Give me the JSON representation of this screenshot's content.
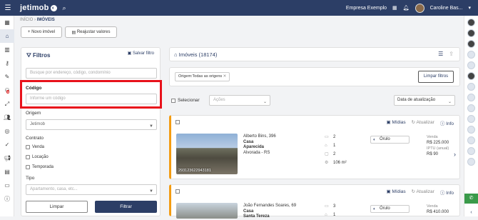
{
  "topbar": {
    "logo": "jetimob",
    "company": "Empresa Exemplo",
    "user": "Caroline Bas...",
    "icons": [
      "menu-icon",
      "search-icon",
      "grid-icon",
      "bell-icon",
      "chevron-down-icon"
    ]
  },
  "breadcrumb": {
    "home": "INÍCIO",
    "sep": "›",
    "current": "IMÓVEIS"
  },
  "actions": {
    "new": "Novo imóvel",
    "readjust": "Reajustar valores"
  },
  "filters": {
    "title": "Filtros",
    "save": "Salvar filtro",
    "search_placeholder": "Busque por endereço, código, condomínio",
    "code_label": "Código",
    "code_placeholder": "Informe um código",
    "origin_label": "Origem",
    "origin_value": "Jetimob",
    "contract_label": "Contrato",
    "contract_options": [
      "Venda",
      "Locação",
      "Temporada"
    ],
    "type_label": "Tipo",
    "type_placeholder": "Apartamento, casa, etc...",
    "clear": "Limpar",
    "apply": "Filtrar"
  },
  "listing": {
    "title": "Imóveis (18174)",
    "chip": "Origem:Todas as origens",
    "clear_filters": "Limpar filtros",
    "select_label": "Selecionar",
    "actions_placeholder": "Ações",
    "sort": "Data de atualização"
  },
  "cards": [
    {
      "media": "Mídias",
      "update": "Atualizar",
      "info": "Info",
      "code": "293123622943181",
      "address": "Alberto Bins, 396",
      "type": "Casa",
      "neighborhood": "Aparecida",
      "city": "Alvorada - RS",
      "bedrooms": "2",
      "suites": "1",
      "garage": "2",
      "area": "106 m²",
      "owner": "Órulo",
      "sale_label": "Venda",
      "sale_price": "R$ 225.000",
      "iptu_label": "IPTU (anual)",
      "iptu_value": "R$ 90"
    },
    {
      "media": "Mídias",
      "update": "Atualizar",
      "info": "Info",
      "address": "João Fernandes Soares, 69",
      "type": "Casa",
      "neighborhood": "Santa Tereza",
      "bedrooms": "3",
      "suites": "1",
      "owner": "Órulo",
      "sale_label": "Venda",
      "sale_price": "R$ 410.000"
    }
  ],
  "colors": {
    "primary": "#2c3e66",
    "accent": "#f39c12",
    "highlight": "#e8121b"
  }
}
